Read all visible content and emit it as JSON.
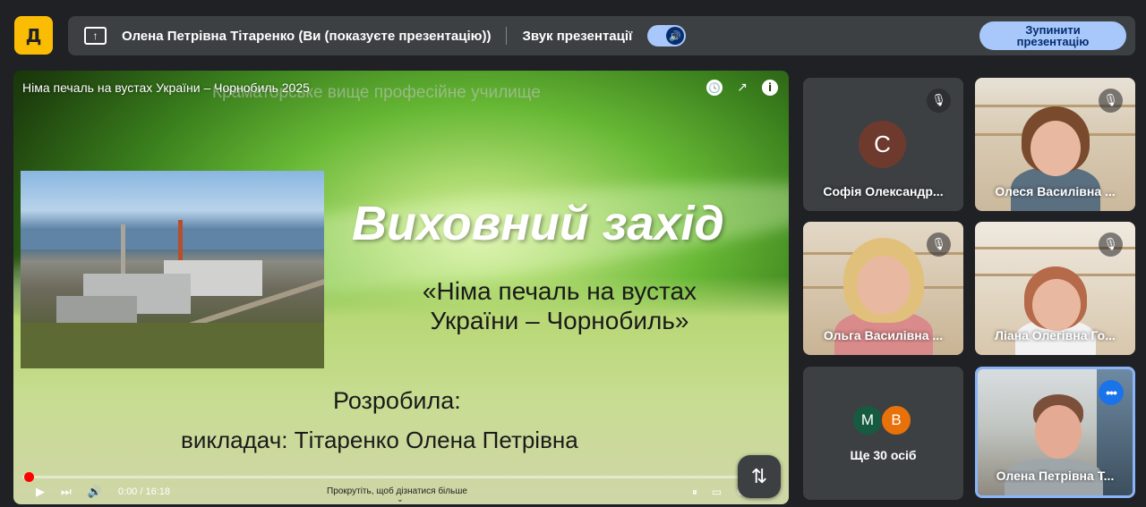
{
  "top_bar": {
    "logo_glyph": "Д",
    "presenter": "Олена Петрівна Тітаренко (Ви (показуєте презентацію))",
    "audio_label": "Звук презентації",
    "toggle_glyph": "🔊",
    "stop_button": "Зупинити презентацію"
  },
  "video": {
    "title": "Німа печаль на вустах України – Чорнобиль 2025",
    "watermark": "Краматорське вище професійне училище",
    "slide_heading": "Виховний захід",
    "slide_subtitle": "«Німа печаль на вустах України – Чорнобиль»",
    "author_label": "Розробила:",
    "author": "викладач: Тітаренко Олена Петрівна",
    "time": "0:00 / 16:18",
    "scroll_hint": "Прокрутіть, щоб дізнатися більше",
    "progress": 0.0,
    "icons": {
      "clock": "🕓",
      "share": "↗",
      "info": "i",
      "play": "▶",
      "next": "⏭",
      "volume": "🔊",
      "pause_toggle": "⏸",
      "subtitles": "▭",
      "settings": "⚙",
      "chevron": "⌄"
    }
  },
  "fab_glyph": "⇅",
  "participants": [
    {
      "name": "Софія Олександр...",
      "initial": "С",
      "muted": true
    },
    {
      "name": "Олеся Василівна ...",
      "muted": true
    },
    {
      "name": "Ольга Василівна ...",
      "muted": true
    },
    {
      "name": "Ліана Олегівна Го...",
      "muted": true
    },
    {
      "more_label": "Ще 30 осіб",
      "avatars": [
        "М",
        "В"
      ]
    },
    {
      "name": "Олена Петрівна Т...",
      "menu_glyph": "•••"
    }
  ],
  "mute_glyph": "🎙",
  "colors": {
    "accent": "#a8c7fa",
    "logo": "#fbbc04",
    "tile_bg": "#3c4043",
    "page_bg": "#202124",
    "active_border": "#8ab4f8"
  }
}
